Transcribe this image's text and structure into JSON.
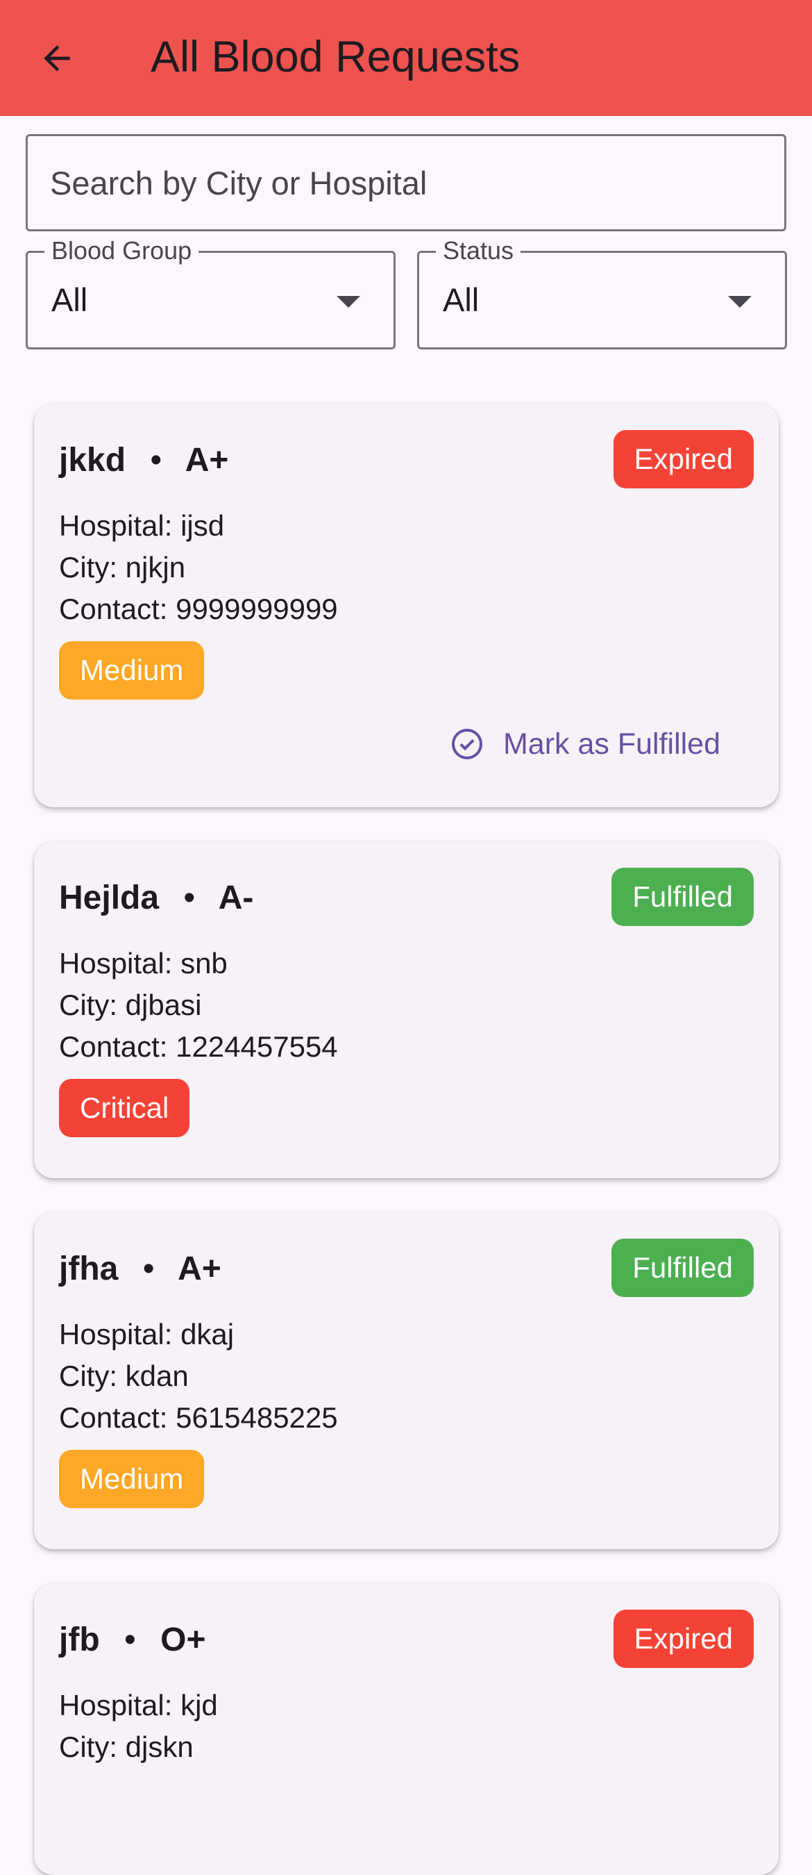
{
  "appbar": {
    "title": "All Blood Requests",
    "back_icon": "arrow-back-icon"
  },
  "search": {
    "placeholder": "Search by City or Hospital",
    "value": ""
  },
  "filters": {
    "blood_group": {
      "label": "Blood Group",
      "value": "All"
    },
    "status": {
      "label": "Status",
      "value": "All"
    }
  },
  "colors": {
    "appbar": "#ef5350",
    "expired": "#f44336",
    "fulfilled": "#4caf50",
    "medium": "#ffa726",
    "critical": "#f44336",
    "action": "#6750a4"
  },
  "requests": [
    {
      "name": "jkkd",
      "separator": "•",
      "blood_group": "A+",
      "status": "Expired",
      "hospital": "Hospital: ijsd",
      "city": "City: njkjn",
      "contact": "Contact: 9999999999",
      "priority": "Medium",
      "action": "Mark as Fulfilled"
    },
    {
      "name": "Hejlda",
      "separator": "•",
      "blood_group": "A-",
      "status": "Fulfilled",
      "hospital": "Hospital: snb",
      "city": "City: djbasi",
      "contact": "Contact: 1224457554",
      "priority": "Critical"
    },
    {
      "name": "jfha",
      "separator": "•",
      "blood_group": "A+",
      "status": "Fulfilled",
      "hospital": "Hospital: dkaj",
      "city": "City: kdan",
      "contact": "Contact: 5615485225",
      "priority": "Medium"
    },
    {
      "name": "jfb",
      "separator": "•",
      "blood_group": "O+",
      "status": "Expired",
      "hospital": "Hospital: kjd",
      "city": "City: djskn"
    }
  ]
}
